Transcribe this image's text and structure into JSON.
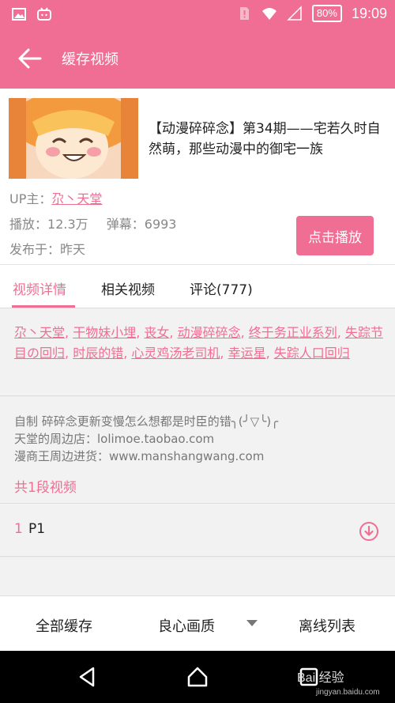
{
  "status_bar": {
    "battery": "80%",
    "time": "19:09"
  },
  "app_bar": {
    "title": "缓存视频"
  },
  "video": {
    "title": "【动漫碎碎念】第34期——宅若久时自然萌，那些动漫中的御宅一族",
    "up_label": "UP主：",
    "up_name": "尕丶天堂",
    "plays_label": "播放：",
    "plays": "12.3万",
    "danmaku_label": "弹幕：",
    "danmaku": "6993",
    "published_label": "发布于：",
    "published": "昨天",
    "play_button": "点击播放"
  },
  "tabs": [
    {
      "label": "视频详情"
    },
    {
      "label": "相关视频"
    },
    {
      "label": "评论(777)"
    }
  ],
  "tags": [
    "尕丶天堂",
    "干物妹小埋",
    "丧女",
    "动漫碎碎念",
    "终于务正业系列",
    "失踪节目の回归",
    "时辰的错",
    "心灵鸡汤老司机",
    "幸运星",
    "失踪人口回归"
  ],
  "description": {
    "line1": "自制 碎碎念更新变慢怎么想都是时臣的错╮(╯▽╰)╭",
    "line2": "天堂的周边店：lolimoe.taobao.com",
    "line3": "漫商王周边进货：www.manshangwang.com"
  },
  "segments": {
    "count_text": "共1段视频",
    "items": [
      {
        "index": "1",
        "name": "P1"
      }
    ]
  },
  "bottom_bar": {
    "cache_all": "全部缓存",
    "quality": "良心画质",
    "offline_list": "离线列表"
  },
  "watermark": {
    "text": "Bai 经验",
    "url": "jingyan.baidu.com"
  },
  "colors": {
    "accent": "#f06d93",
    "background": "#f2f2f2"
  }
}
